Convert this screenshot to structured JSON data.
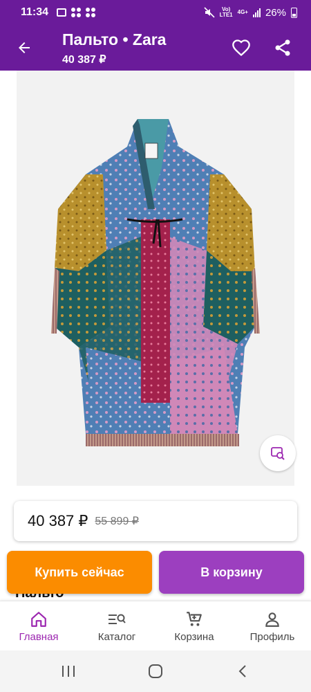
{
  "status_bar": {
    "time": "11:34",
    "network_top": "Vo)",
    "network_bottom": "LTE1",
    "signal_label": "4G+",
    "battery": "26%"
  },
  "app_bar": {
    "title": "Пальто • Zara",
    "subtitle": "40 387 ₽"
  },
  "price": {
    "current": "40 387 ₽",
    "old": "55 899 ₽"
  },
  "partial_text": "Пальто",
  "actions": {
    "buy_now": "Купить сейчас",
    "add_to_cart": "В корзину"
  },
  "bottom_nav": [
    {
      "label": "Главная",
      "icon": "home-icon",
      "active": true
    },
    {
      "label": "Каталог",
      "icon": "catalog-search-icon",
      "active": false
    },
    {
      "label": "Корзина",
      "icon": "cart-icon",
      "active": false
    },
    {
      "label": "Профиль",
      "icon": "profile-icon",
      "active": false
    }
  ],
  "colors": {
    "primary": "#6a1b9a",
    "accent": "#9c27b0",
    "buy_now": "#fb8c00",
    "cart": "#9c3fbf"
  }
}
